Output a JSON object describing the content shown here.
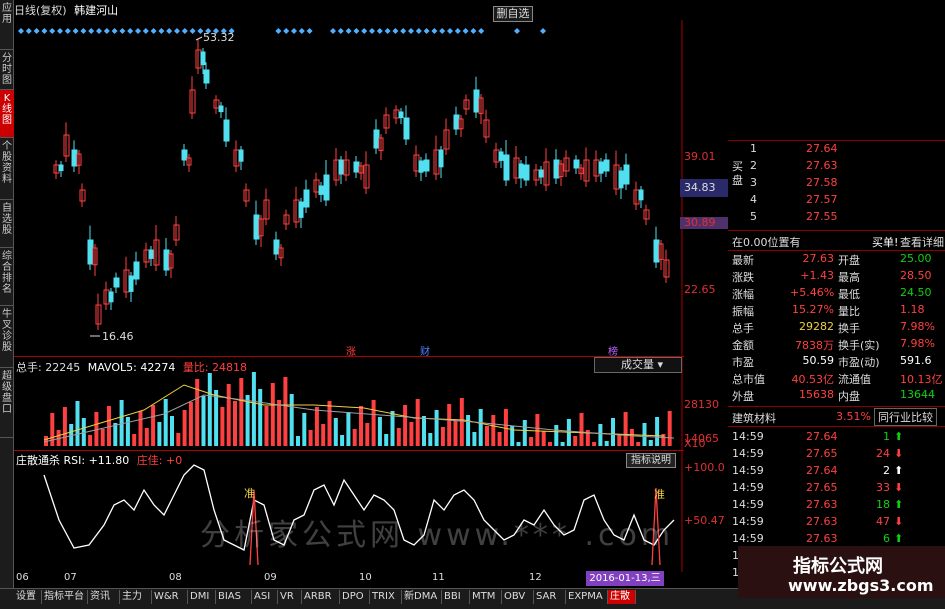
{
  "left_tabs": [
    "应用",
    "分时图",
    "K线图",
    "个股资料",
    "自选股",
    "综合排名",
    "牛叉诊股",
    "超级盘口"
  ],
  "title": {
    "period": "日线(复权)",
    "stock": "韩建河山"
  },
  "add_fav": "删自选",
  "k_labels": {
    "high": "53.32",
    "low": "16.46"
  },
  "price_axis": [
    "39.01",
    "34.83",
    "30.89",
    "22.65"
  ],
  "current_price_tag": "34.83",
  "marks": [
    "涨",
    "财",
    "榜"
  ],
  "volume": {
    "label1": "总手: 22245",
    "label2": "MAVOL5: 42274",
    "label3": "量比: 24818",
    "btn": "成交量",
    "axis": [
      "28130",
      "14065",
      "X10"
    ]
  },
  "rsi": {
    "label1": "庄散通杀 RSI: +11.80",
    "label2": "庄佳: +0",
    "btn": "指标说明",
    "axis": [
      "+100.0",
      "+50.47"
    ],
    "sell_mark": "准"
  },
  "x_axis": [
    "06",
    "07",
    "08",
    "09",
    "10",
    "11",
    "12"
  ],
  "date_box": "2016-01-13,三",
  "bottom_tabs": [
    "设置",
    "指标平台",
    "资讯",
    "主力",
    "W&R",
    "DMI",
    "BIAS",
    "ASI",
    "VR",
    "ARBR",
    "DPO",
    "TRIX",
    "新DMA",
    "BBI",
    "MTM",
    "OBV",
    "SAR",
    "EXPMA",
    "庄散"
  ],
  "watermark": "分析家公式网 www.*** .com",
  "orderbook": {
    "buy_label": "买盘",
    "rows": [
      [
        "1",
        "27.64"
      ],
      [
        "2",
        "27.63"
      ],
      [
        "3",
        "27.58"
      ],
      [
        "4",
        "27.57"
      ],
      [
        "5",
        "27.55"
      ]
    ]
  },
  "pos_row": {
    "text": "在0.00位置有",
    "buy": "买单!",
    "detail": "查看详细"
  },
  "quote": [
    [
      "最新",
      "27.63",
      "开盘",
      "25.00"
    ],
    [
      "涨跌",
      "+1.43",
      "最高",
      "28.50"
    ],
    [
      "涨幅",
      "+5.46%",
      "最低",
      "24.50"
    ],
    [
      "振幅",
      "15.27%",
      "量比",
      "1.18"
    ],
    [
      "总手",
      "29282",
      "换手",
      "7.98%"
    ],
    [
      "金额",
      "7838万",
      "换手(实)",
      "7.98%"
    ],
    [
      "市盈",
      "50.59",
      "市盈(动)",
      "591.6"
    ],
    [
      "总市值",
      "40.53亿",
      "流通值",
      "10.13亿"
    ],
    [
      "外盘",
      "15638",
      "内盘",
      "13644"
    ]
  ],
  "industry": {
    "name": "建筑材料",
    "pct": "3.51%",
    "btn": "同行业比较"
  },
  "ticks": [
    [
      "14:59",
      "27.64",
      "1"
    ],
    [
      "14:59",
      "27.65",
      "24"
    ],
    [
      "14:59",
      "27.64",
      "2"
    ],
    [
      "14:59",
      "27.65",
      "33"
    ],
    [
      "14:59",
      "27.63",
      "18"
    ],
    [
      "14:59",
      "27.63",
      "47"
    ],
    [
      "14:59",
      "27.63",
      "6"
    ],
    [
      "14:59",
      "27.63",
      ""
    ],
    [
      "14:59",
      "27.63",
      ""
    ],
    [
      "15:00",
      "27.63",
      ""
    ]
  ],
  "logo": {
    "line1": "指标公式网",
    "line2": "www.zbgs3.com"
  },
  "colors": {
    "up": "#ff4040",
    "down": "#50e0f0",
    "bg": "#000000",
    "axis": "#a00000"
  }
}
